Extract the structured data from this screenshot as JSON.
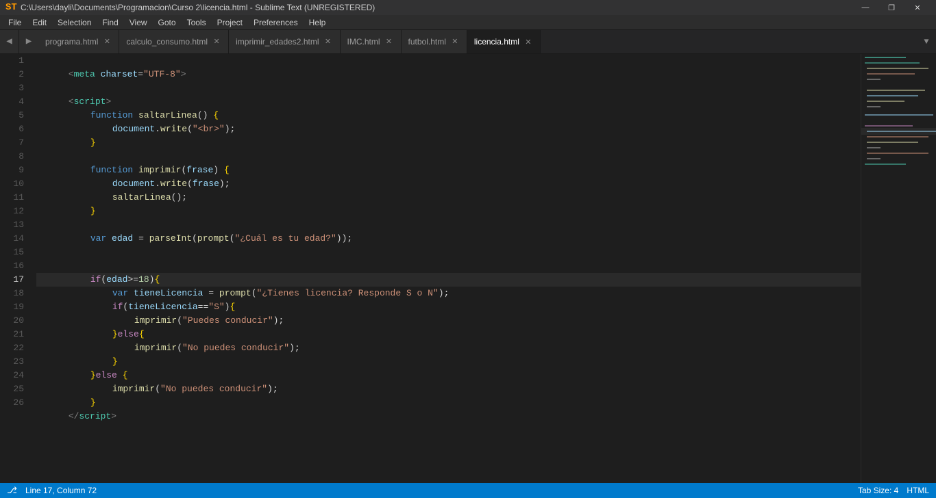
{
  "titleBar": {
    "icon": "ST",
    "title": "C:\\Users\\dayli\\Documents\\Programacion\\Curso 2\\licencia.html - Sublime Text (UNREGISTERED)",
    "minimize": "—",
    "maximize": "❐",
    "close": "✕"
  },
  "menuBar": {
    "items": [
      "File",
      "Edit",
      "Selection",
      "Find",
      "View",
      "Goto",
      "Tools",
      "Project",
      "Preferences",
      "Help"
    ]
  },
  "tabs": [
    {
      "label": "programa.html",
      "active": false,
      "hasClose": true
    },
    {
      "label": "calculo_consumo.html",
      "active": false,
      "hasClose": true
    },
    {
      "label": "imprimir_edades2.html",
      "active": false,
      "hasClose": true
    },
    {
      "label": "IMC.html",
      "active": false,
      "hasClose": true
    },
    {
      "label": "futbol.html",
      "active": false,
      "hasClose": true
    },
    {
      "label": "licencia.html",
      "active": true,
      "hasClose": true
    }
  ],
  "statusBar": {
    "left": {
      "position": "Line 17, Column 72"
    },
    "right": {
      "tabSize": "Tab Size: 4",
      "language": "HTML"
    }
  },
  "lines": [
    "1",
    "2",
    "3",
    "4",
    "5",
    "6",
    "7",
    "8",
    "9",
    "10",
    "11",
    "12",
    "13",
    "14",
    "15",
    "16",
    "17",
    "18",
    "19",
    "20",
    "21",
    "22",
    "23",
    "24",
    "25",
    "26"
  ]
}
